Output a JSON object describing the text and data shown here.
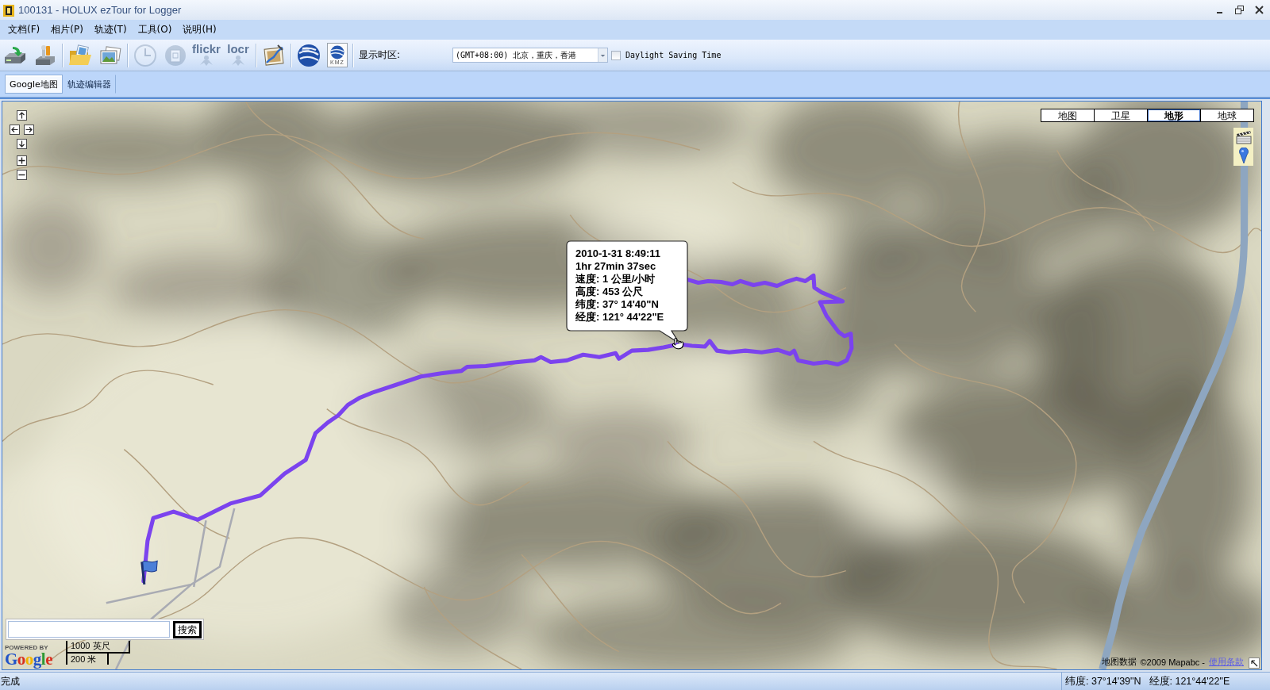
{
  "window": {
    "title": "100131 - HOLUX ezTour for Logger"
  },
  "menu": [
    {
      "label": "文档(F)"
    },
    {
      "label": "相片(P)"
    },
    {
      "label": "轨迹(T)"
    },
    {
      "label": "工具(O)"
    },
    {
      "label": "说明(H)"
    }
  ],
  "toolbar": {
    "groups": [
      [
        {
          "kind": "drive",
          "disabled": false
        },
        {
          "kind": "device",
          "disabled": false
        }
      ],
      [
        {
          "kind": "folder",
          "disabled": false
        },
        {
          "kind": "photos",
          "disabled": false
        }
      ],
      [
        {
          "kind": "clock",
          "disabled": true
        },
        {
          "kind": "badge",
          "disabled": true
        },
        {
          "kind": "logo",
          "label": "flickr",
          "disabled": true
        },
        {
          "kind": "logo",
          "label": "locr",
          "disabled": true
        }
      ],
      [
        {
          "kind": "photomap",
          "disabled": false
        }
      ],
      [
        {
          "kind": "globe",
          "disabled": false
        },
        {
          "kind": "file",
          "label": "KMZ",
          "disabled": false
        }
      ]
    ],
    "timezone": {
      "label": "显示时区:",
      "value": "(GMT+08:00) 北京，重庆，香港"
    },
    "daylight_saving": {
      "label": "Daylight Saving Time",
      "checked": false
    }
  },
  "tabs": [
    {
      "label": "Google地图",
      "selected": true
    },
    {
      "label": "轨迹编辑器",
      "selected": false
    }
  ],
  "map": {
    "map_types": [
      {
        "label": "地图",
        "selected": false
      },
      {
        "label": "卫星",
        "selected": false
      },
      {
        "label": "地形",
        "selected": true
      },
      {
        "label": "地球",
        "selected": false
      }
    ],
    "info_popup": {
      "lines": [
        "2010-1-31 8:49:11",
        "1hr 27min 37sec",
        "速度: 1 公里/小时",
        "高度: 453 公尺",
        "纬度: 37° 14'40\"N",
        "经度: 121° 44'22\"E"
      ]
    },
    "search": {
      "button": "搜索"
    },
    "logo": {
      "powered_by": "POWERED BY",
      "name": "Google"
    },
    "scale": {
      "imperial": "1000 英尺",
      "metric": "200 米"
    },
    "attribution": {
      "data_label": "地图数据",
      "copyright": "©2009 Mapabc -",
      "terms_link": "使用条款"
    }
  },
  "status_bar": {
    "message": "完成",
    "latitude": "纬度: 37°14'39\"N",
    "longitude": "经度: 121°44'22\"E"
  }
}
